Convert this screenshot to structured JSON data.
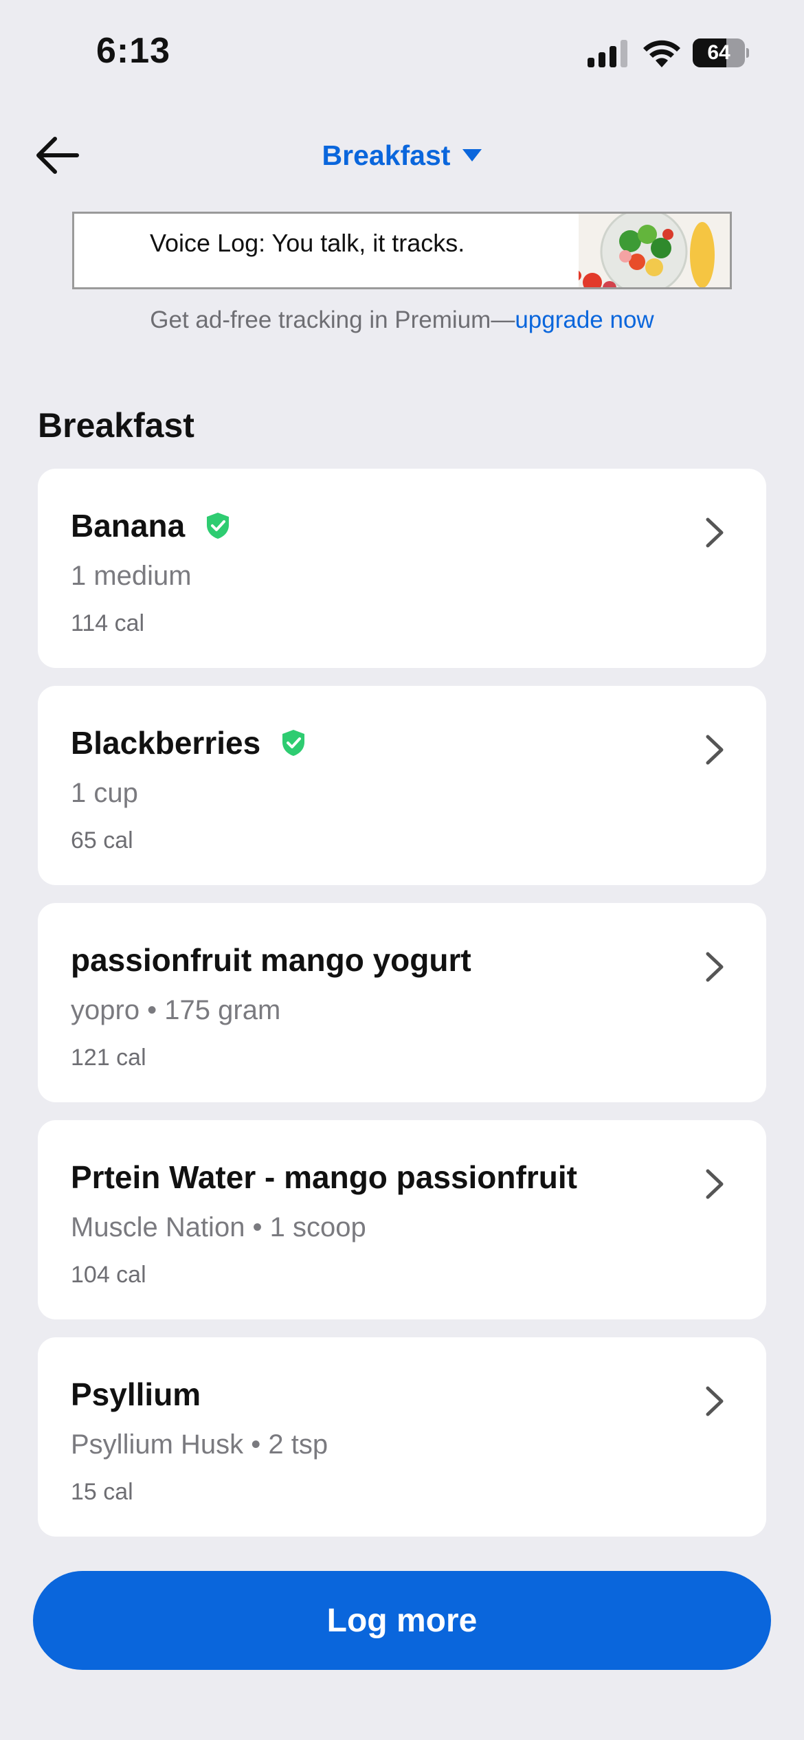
{
  "status_bar": {
    "time": "6:13",
    "battery_level": "64",
    "battery_fraction": 0.64
  },
  "nav": {
    "title": "Breakfast",
    "back_icon": "back-arrow-icon",
    "dropdown_icon": "caret-down-icon"
  },
  "ad": {
    "text": "Voice Log: You talk, it tracks."
  },
  "premium": {
    "prefix": "Get ad-free tracking in Premium—",
    "link": "upgrade now"
  },
  "section_title": "Breakfast",
  "foods": [
    {
      "name": "Banana",
      "detail": "1 medium",
      "calories": "114 cal",
      "verified": true
    },
    {
      "name": "Blackberries",
      "detail": "1 cup",
      "calories": "65 cal",
      "verified": true
    },
    {
      "name": "passionfruit mango yogurt",
      "detail": "yopro • 175 gram",
      "calories": "121 cal",
      "verified": false
    },
    {
      "name": "Prtein Water - mango passionfruit",
      "detail": "Muscle Nation • 1 scoop",
      "calories": "104 cal",
      "verified": false
    },
    {
      "name": "Psyllium",
      "detail": "Psyllium Husk • 2 tsp",
      "calories": "15 cal",
      "verified": false
    }
  ],
  "log_more_label": "Log more",
  "colors": {
    "accent": "#0a66dc",
    "verified_green": "#2ecc71",
    "background": "#ececf1"
  }
}
